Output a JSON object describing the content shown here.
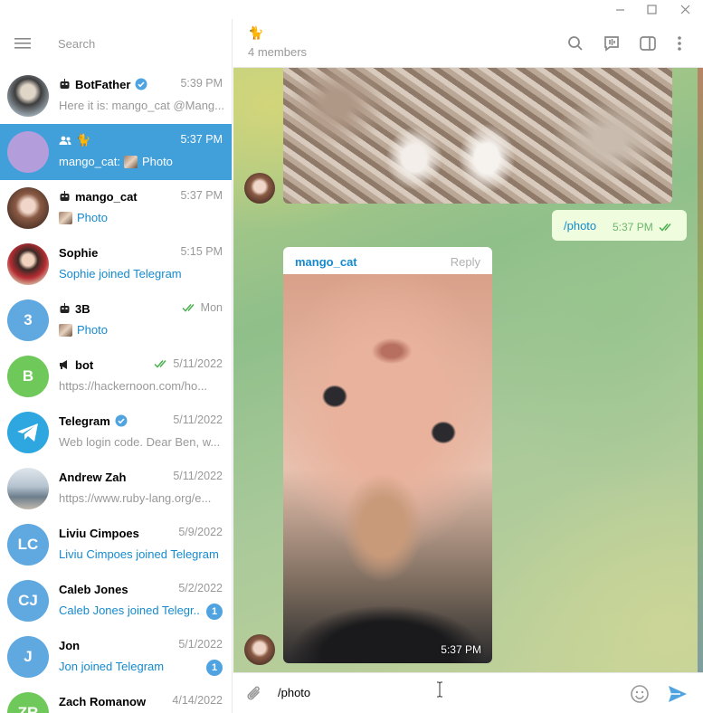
{
  "window": {
    "controls": [
      "minimize-icon",
      "maximize-icon",
      "close-icon"
    ]
  },
  "sidebar": {
    "search_placeholder": "Search",
    "chats": [
      {
        "title": "BotFather",
        "time": "5:39 PM",
        "preview": "Here it is: mango_cat @Mang...",
        "avatar_color": "#607d8b",
        "verified": true,
        "bot": true
      },
      {
        "title": "🐈",
        "time": "5:37 PM",
        "sender": "mango_cat:",
        "preview": "Photo",
        "avatar_color": "#b39ddb",
        "group": true,
        "active": true
      },
      {
        "title": "mango_cat",
        "time": "5:37 PM",
        "preview": "Photo",
        "bot": true
      },
      {
        "title": "Sophie",
        "time": "5:15 PM",
        "preview": "Sophie joined Telegram"
      },
      {
        "title": "3B",
        "time": "Mon",
        "preview": "Photo",
        "avatar_letter": "3",
        "avatar_color": "#5fa8e0",
        "bot": true
      },
      {
        "title": "bot",
        "time": "5/11/2022",
        "preview": "https://hackernoon.com/ho...",
        "avatar_letter": "B",
        "avatar_color": "#6fc95a",
        "channel": true
      },
      {
        "title": "Telegram",
        "time": "5/11/2022",
        "preview": "Web login code. Dear Ben, w...",
        "verified": true
      },
      {
        "title": "Andrew Zah",
        "time": "5/11/2022",
        "preview": "https://www.ruby-lang.org/e..."
      },
      {
        "title": "Liviu Cimpoes",
        "time": "5/9/2022",
        "preview": "Liviu Cimpoes joined Telegram",
        "avatar_letter": "LC",
        "avatar_color": "#5fa8e0"
      },
      {
        "title": "Caleb Jones",
        "time": "5/2/2022",
        "preview": "Caleb Jones joined Telegr...",
        "avatar_letter": "CJ",
        "avatar_color": "#5fa8e0",
        "unread": "1"
      },
      {
        "title": "Jon",
        "time": "5/1/2022",
        "preview": "Jon joined Telegram",
        "avatar_letter": "J",
        "avatar_color": "#5fa8e0",
        "unread": "1"
      },
      {
        "title": "Zach Romanow",
        "time": "4/14/2022",
        "preview": "",
        "avatar_letter": "ZR",
        "avatar_color": "#6fc95a"
      }
    ]
  },
  "chat": {
    "title": "🐈",
    "subtitle": "4 members",
    "outgoing": {
      "text": "/photo",
      "time": "5:37 PM"
    },
    "incoming": {
      "sender": "mango_cat",
      "reply": "Reply",
      "time": "5:37 PM"
    },
    "composer": {
      "value": "/photo"
    }
  },
  "colors": {
    "accent": "#419fd9",
    "link": "#168acd",
    "outgoing_bubble": "#effdde"
  }
}
